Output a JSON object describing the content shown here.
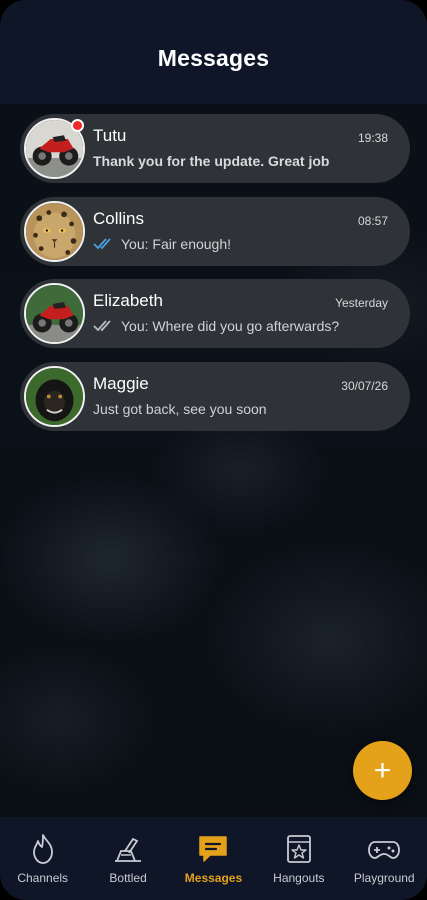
{
  "header": {
    "title": "Messages"
  },
  "chats": [
    {
      "name": "Tutu",
      "time": "19:38",
      "preview": "Thank you for the update. Great job",
      "unread": true,
      "read_receipt": null,
      "avatar": "motorcycle"
    },
    {
      "name": "Collins",
      "time": "08:57",
      "preview": "You: Fair enough!",
      "unread": false,
      "read_receipt": "read",
      "avatar": "leopard"
    },
    {
      "name": "Elizabeth",
      "time": "Yesterday",
      "preview": "You: Where did you go afterwards?",
      "unread": false,
      "read_receipt": "delivered",
      "avatar": "motorcycle"
    },
    {
      "name": "Maggie",
      "time": "30/07/26",
      "preview": "Just got back, see you soon",
      "unread": false,
      "read_receipt": null,
      "avatar": "monkey"
    }
  ],
  "fab": {
    "label": "+"
  },
  "tabs": [
    {
      "label": "Channels",
      "icon": "flame-icon"
    },
    {
      "label": "Bottled",
      "icon": "bottle-icon"
    },
    {
      "label": "Messages",
      "icon": "chat-bubble-icon",
      "active": true
    },
    {
      "label": "Hangouts",
      "icon": "star-card-icon"
    },
    {
      "label": "Playground",
      "icon": "gamepad-icon"
    }
  ],
  "colors": {
    "accent": "#e4a21b",
    "bar": "#0e1627",
    "card": "#2f3237",
    "unread": "#ee2a2a",
    "read_check": "#4aa3e0"
  }
}
